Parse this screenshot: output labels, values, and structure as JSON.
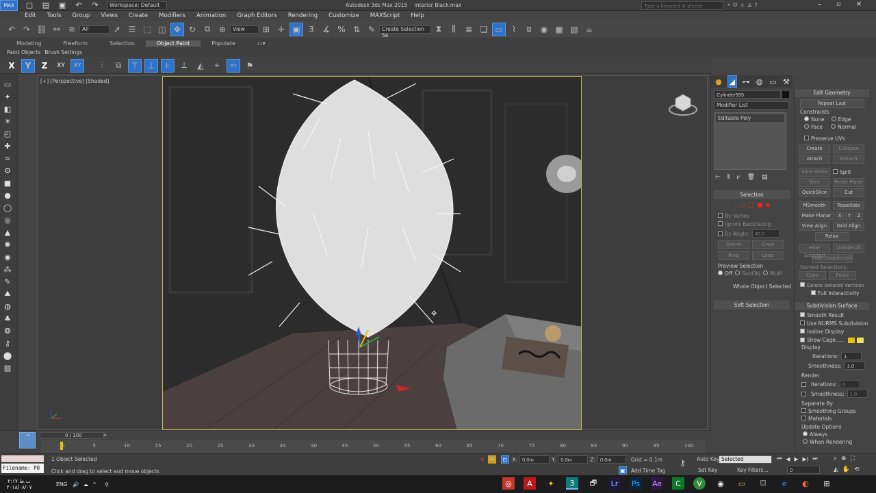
{
  "titlebar": {
    "title": "Autodesk 3ds Max 2015",
    "file": "interior Black.max",
    "workspace": "Workspace: Default",
    "search_placeholder": "Type a keyword or phrase"
  },
  "menu": [
    "Edit",
    "Tools",
    "Group",
    "Views",
    "Create",
    "Modifiers",
    "Animation",
    "Graph Editors",
    "Rendering",
    "Customize",
    "MAXScript",
    "Help"
  ],
  "toolbar": {
    "filter": "All",
    "view": "View",
    "selection_set": "Create Selection Se"
  },
  "ribbon": {
    "tabs": [
      "Modeling",
      "Freeform",
      "Selection",
      "Object Paint",
      "Populate"
    ],
    "active_tab": "Object Paint",
    "sub": [
      "Paint Objects",
      "Brush Settings"
    ]
  },
  "axisbar": [
    "X",
    "Y",
    "Z",
    "XY",
    "XY"
  ],
  "viewport": {
    "label": "[+] [Perspective] [Shaded]"
  },
  "cmd": {
    "object_name": "Cylinder555",
    "modifier_list": "Modifier List",
    "stack_item": "Editable Poly",
    "selection_header": "Selection",
    "by_vertex": "By Vertex",
    "ignore_backfacing": "Ignore Backfacing",
    "by_angle": "By Angle:",
    "by_angle_value": "45.0",
    "shrink": "Shrink",
    "grow": "Grow",
    "ring": "Ring",
    "loop": "Loop",
    "preview_selection": "Preview Selection",
    "preview_opts": [
      "Off",
      "SubObj",
      "Multi"
    ],
    "whole_object": "Whole Object Selected",
    "soft_selection": "Soft Selection"
  },
  "edit_geometry": {
    "header": "Edit Geometry",
    "repeat_last": "Repeat Last",
    "constraints": "Constraints",
    "constraint_opts": [
      "None",
      "Edge",
      "Face",
      "Normal"
    ],
    "preserve_uvs": "Preserve UVs",
    "create": "Create",
    "collapse": "Collapse",
    "attach": "Attach",
    "detach": "Detach",
    "slice_plane": "Slice Plane",
    "split": "Split",
    "slice": "Slice",
    "reset_plane": "Reset Plane",
    "quickslice": "QuickSlice",
    "cut": "Cut",
    "msmooth": "MSmooth",
    "tessellate": "Tessellate",
    "make_planar": "Make Planar",
    "x": "X",
    "y": "Y",
    "z": "Z",
    "view_align": "View Align",
    "grid_align": "Grid Align",
    "relax": "Relax",
    "hide_selected": "Hide Selected",
    "unhide_all": "Unhide All",
    "hide_unselected": "Hide Unselected",
    "named_selections": "Named Selections:",
    "copy": "Copy",
    "paste": "Paste",
    "delete_isolated": "Delete Isolated Vertices",
    "full_interactivity": "Full Interactivity"
  },
  "subdivision": {
    "header": "Subdivision Surface",
    "smooth_result": "Smooth Result",
    "use_nurms": "Use NURMS Subdivision",
    "isoline": "Isoline Display",
    "show_cage": "Show Cage......",
    "display": "Display",
    "iterations": "Iterations:",
    "iterations_value": "1",
    "smoothness": "Smoothness:",
    "smoothness_value": "1.0",
    "render": "Render",
    "r_iterations": "Iterations:",
    "r_iterations_value": "0",
    "r_smoothness": "Smoothness:",
    "r_smoothness_value": "1.0",
    "separate_by": "Separate By",
    "smoothing_groups": "Smoothing Groups",
    "materials": "Materials",
    "update_options": "Update Options",
    "always": "Always",
    "when_rendering": "When Rendering"
  },
  "timeline": {
    "frame": "0 / 100",
    "ticks": [
      "0",
      "5",
      "10",
      "15",
      "20",
      "25",
      "30",
      "35",
      "40",
      "45",
      "50",
      "55",
      "60",
      "65",
      "70",
      "75",
      "80",
      "85",
      "90",
      "95",
      "100"
    ]
  },
  "status": {
    "filename": "Filename: P0",
    "selected": "1 Object Selected",
    "hint": "Click and drag to select and move objects",
    "x_label": "X:",
    "x_value": "0.0m",
    "y_label": "Y:",
    "y_value": "0.0m",
    "z_label": "Z:",
    "z_value": "0.0m",
    "grid": "Grid = 0.1m",
    "add_time_tag": "Add Time Tag",
    "auto_key": "Auto Key",
    "set_key": "Set Key",
    "key_mode": "Selected",
    "key_filters": "Key Filters...",
    "frame_field": "0"
  },
  "taskbar": {
    "time": "۲:۱۷ ب.ظ",
    "date": "۲۰۱۸/۰۸/۰۷",
    "lang": "ENG"
  },
  "colors": {
    "accent": "#2f72c9",
    "viewport_border": "#c9b65b",
    "cage_yellow": "#e6c200"
  }
}
